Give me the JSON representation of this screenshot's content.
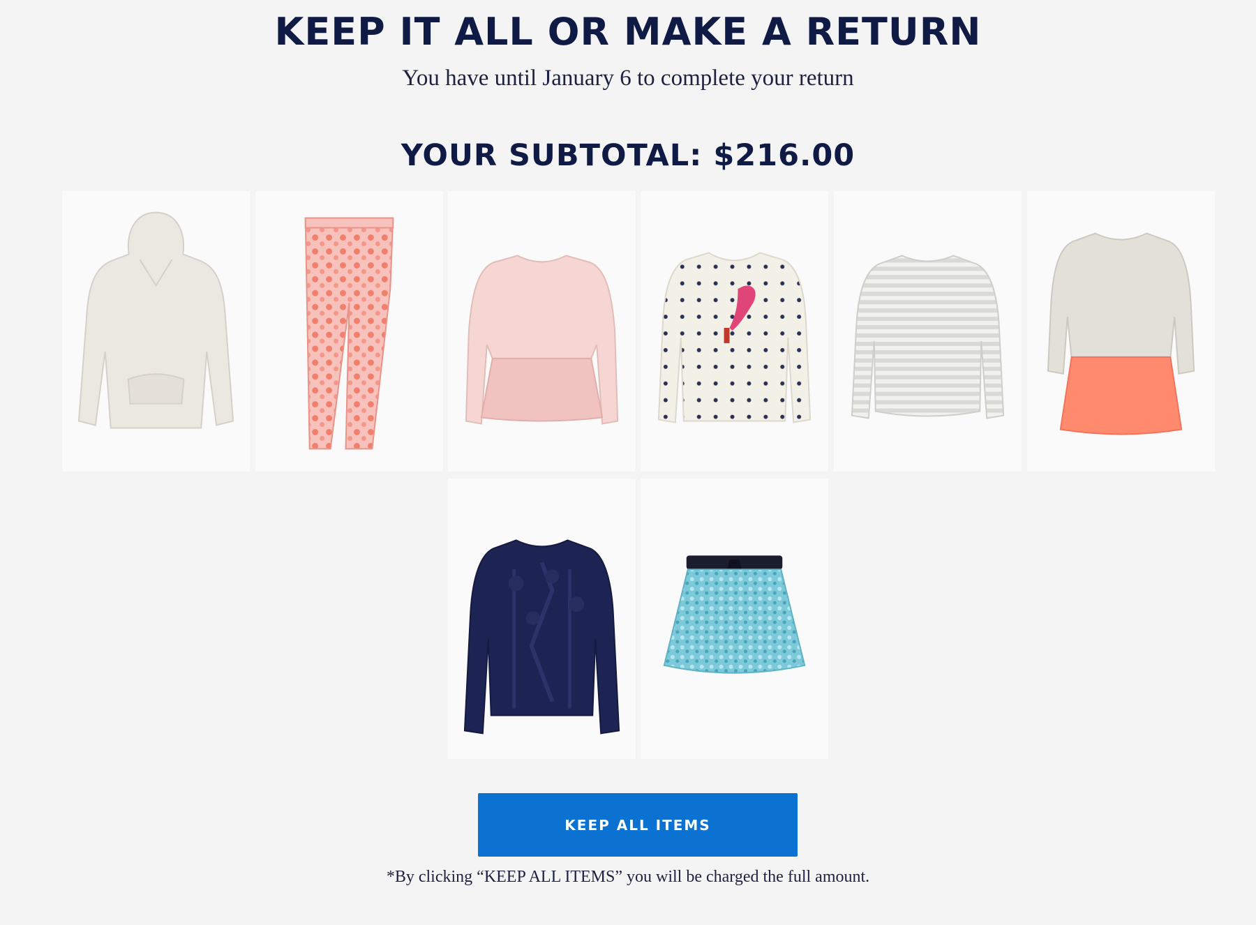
{
  "header": {
    "title": "KEEP IT ALL OR MAKE A RETURN",
    "subtitle": "You have until January 6 to complete your return",
    "subtotal": "YOUR SUBTOTAL: $216.00"
  },
  "items": [
    {
      "icon": "hoodie-icon",
      "color": "#ebe7e1"
    },
    {
      "icon": "leggings-icon",
      "color": "#f4a59a"
    },
    {
      "icon": "peplum-top-icon",
      "color": "#f5d6d3"
    },
    {
      "icon": "polka-dot-sweater-icon",
      "color": "#f3f0e8"
    },
    {
      "icon": "striped-tee-icon",
      "color": "#e5e5e2"
    },
    {
      "icon": "tulle-dress-icon",
      "color": "#ff8a6e"
    },
    {
      "icon": "cable-knit-sweater-icon",
      "color": "#1d2352"
    },
    {
      "icon": "sequin-skirt-icon",
      "color": "#7cc9d9"
    }
  ],
  "cta": {
    "label": "KEEP ALL ITEMS",
    "color": "#0b72d1"
  },
  "disclaimer": "*By clicking “KEEP ALL ITEMS” you will be charged the full amount."
}
